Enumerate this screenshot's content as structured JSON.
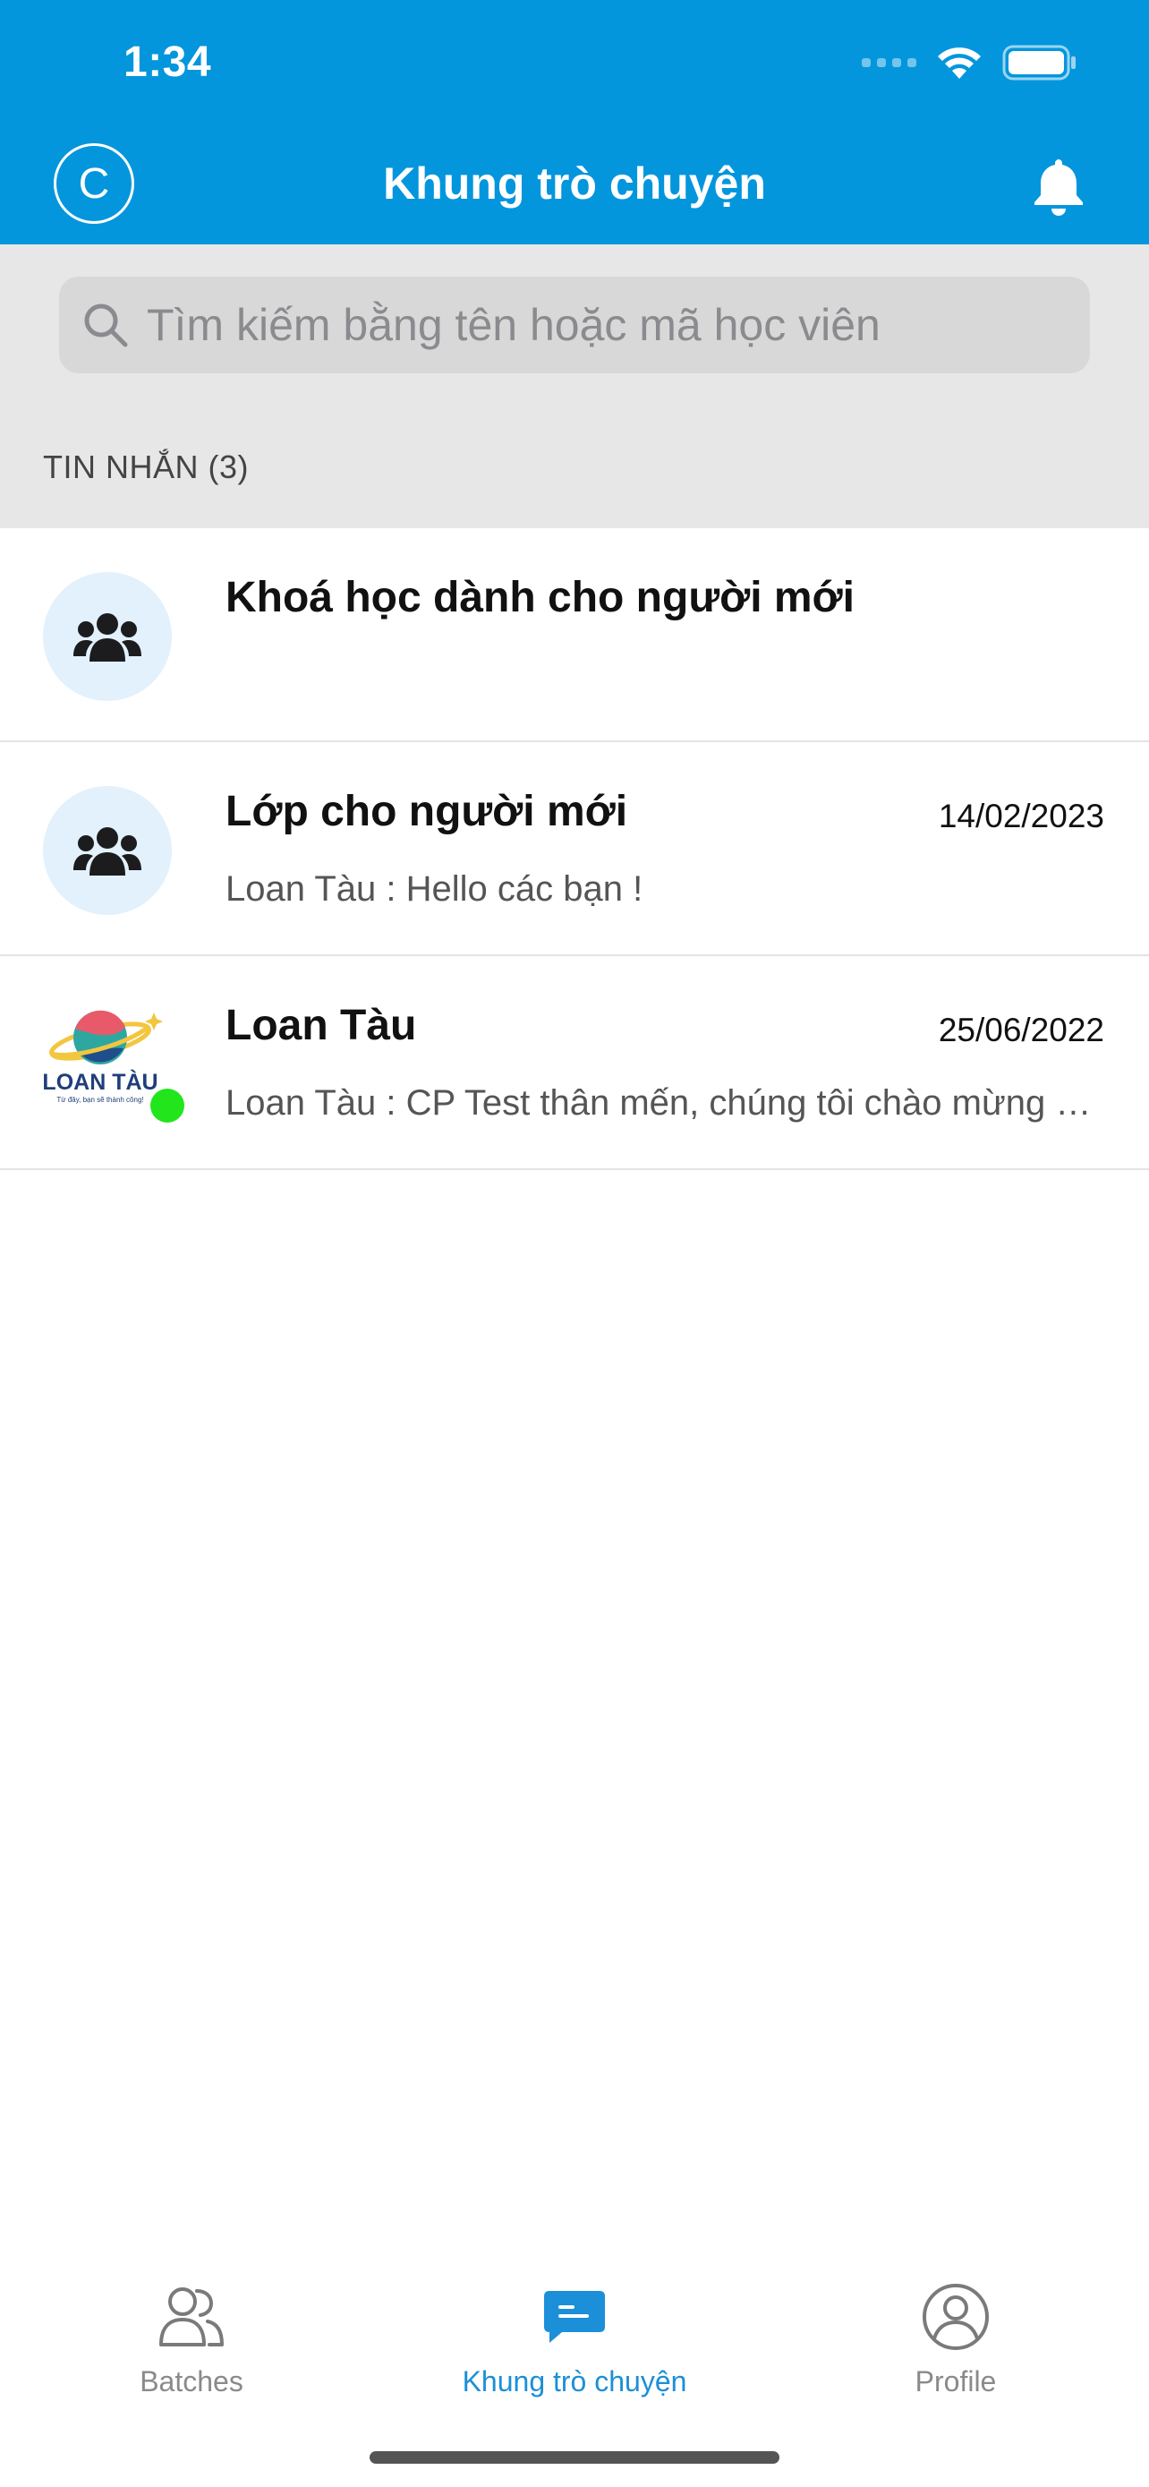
{
  "status_bar": {
    "time": "1:34"
  },
  "header": {
    "avatar_letter": "C",
    "title": "Khung trò chuyện"
  },
  "search": {
    "placeholder": "Tìm kiếm bằng tên hoặc mã học viên",
    "value": ""
  },
  "section": {
    "label": "TIN NHẮN (3)"
  },
  "conversations": [
    {
      "name": "Khoá học dành cho người mới",
      "date": "",
      "preview": "",
      "avatar": "group-icon"
    },
    {
      "name": "Lớp cho người mới",
      "date": "14/02/2023",
      "preview": "Loan Tàu : Hello các bạn !",
      "avatar": "group-icon"
    },
    {
      "name": "Loan Tàu",
      "date": "25/06/2022",
      "preview": "Loan Tàu : CP Test thân mến, chúng tôi chào mừng bạn đến với Loan Tàu",
      "avatar": "loan-tau-logo",
      "logo_text": "LOAN TÀU",
      "logo_tagline": "Từ đây, bạn sẽ thành công!",
      "online": true
    }
  ],
  "tabbar": {
    "items": [
      {
        "label": "Batches",
        "icon": "batches-icon",
        "active": false
      },
      {
        "label": "Khung trò chuyện",
        "icon": "chat-icon",
        "active": true
      },
      {
        "label": "Profile",
        "icon": "profile-icon",
        "active": false
      }
    ]
  },
  "colors": {
    "primary": "#0396DD",
    "active_tab": "#1B8FD8",
    "online": "#22E51C",
    "avatar_bg": "#E2F1FC"
  }
}
